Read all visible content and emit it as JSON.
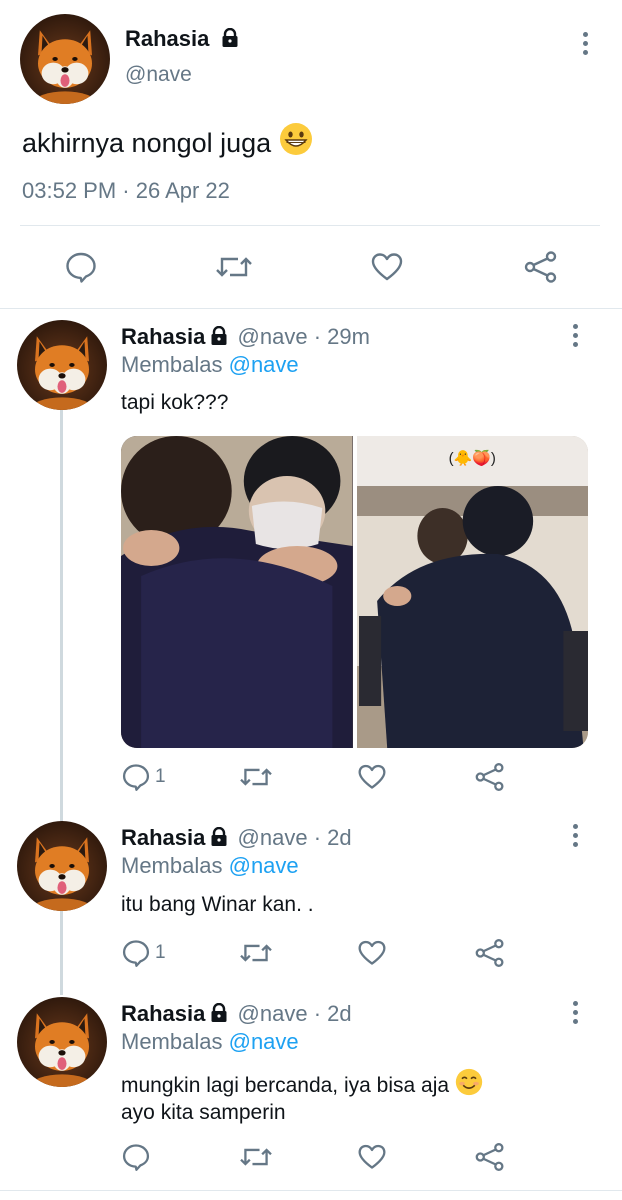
{
  "main_tweet": {
    "display_name": "Rahasia",
    "handle": "@nave",
    "text": "akhirnya nongol juga",
    "timestamp": "03:52 PM · 26 Apr 22"
  },
  "replies": [
    {
      "display_name": "Rahasia",
      "handle": "@nave",
      "time": "· 29m",
      "replying_prefix": "Membalas",
      "replying_to": "@nave",
      "text": "tapi kok???",
      "reply_count": "1",
      "media_caption": "(🐥🍑)"
    },
    {
      "display_name": "Rahasia",
      "handle": "@nave",
      "time": "· 2d",
      "replying_prefix": "Membalas",
      "replying_to": "@nave",
      "text": "itu bang Winar kan. .",
      "reply_count": "1"
    },
    {
      "display_name": "Rahasia",
      "handle": "@nave",
      "time": "· 2d",
      "replying_prefix": "Membalas",
      "replying_to": "@nave",
      "text_line1": "mungkin lagi bercanda, iya bisa aja",
      "text_line2": "ayo kita samperin"
    }
  ],
  "icons": {
    "reply": "speech-bubble-icon",
    "retweet": "retweet-icon",
    "like": "heart-icon",
    "share": "share-icon",
    "lock": "lock-icon",
    "more": "more-vertical-icon"
  },
  "colors": {
    "link": "#1da1f2",
    "muted": "#657786",
    "divider": "#e1e8ed"
  }
}
